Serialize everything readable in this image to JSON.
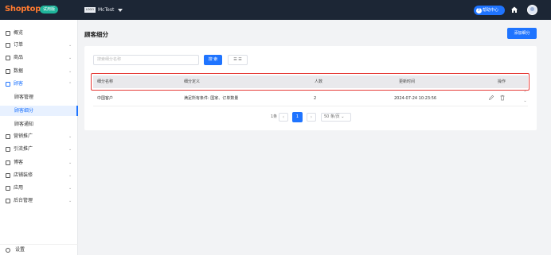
{
  "header": {
    "brand": "Shoptop",
    "badge": "试用版",
    "store_logo": "LOGO",
    "store_name": "McTest",
    "help_label": "帮助中心"
  },
  "sidebar": {
    "items": [
      {
        "label": "概览",
        "icon": "overview-icon"
      },
      {
        "label": "订单",
        "icon": "order-icon"
      },
      {
        "label": "商品",
        "icon": "product-icon"
      },
      {
        "label": "数据",
        "icon": "data-icon"
      },
      {
        "label": "顾客",
        "icon": "customer-icon"
      }
    ],
    "sub_items": [
      {
        "label": "顾客管理"
      },
      {
        "label": "顾客细分"
      },
      {
        "label": "顾客通知"
      }
    ],
    "items2": [
      {
        "label": "营销推广",
        "icon": "marketing-icon"
      },
      {
        "label": "引流推广",
        "icon": "traffic-icon"
      },
      {
        "label": "博客",
        "icon": "blog-icon"
      },
      {
        "label": "店铺装修",
        "icon": "store-decoration-icon"
      },
      {
        "label": "应用",
        "icon": "apps-icon"
      },
      {
        "label": "后台管理",
        "icon": "admin-icon"
      }
    ],
    "settings_label": "设置"
  },
  "main": {
    "title": "顾客细分",
    "add_button": "添加细分",
    "search_placeholder": "搜索细分名称",
    "search_button": "搜 索",
    "view_button": "☰ ☰",
    "columns": [
      "细分名称",
      "细分定义",
      "人数",
      "更新时间",
      "操作"
    ],
    "rows": [
      {
        "name": "中国客户",
        "definition": "满足所有条件:  国家、订单数量",
        "count": "2",
        "updated": "2024-07-24 10:23:56"
      }
    ],
    "pager": {
      "total": "1条",
      "current": "1",
      "page_size": "50 条/页"
    }
  },
  "colors": {
    "primary": "#1f74ff",
    "topbar": "#1c2635",
    "brand": "#ff7a2f",
    "badge": "#1fb59b",
    "highlight": "#e53935"
  }
}
